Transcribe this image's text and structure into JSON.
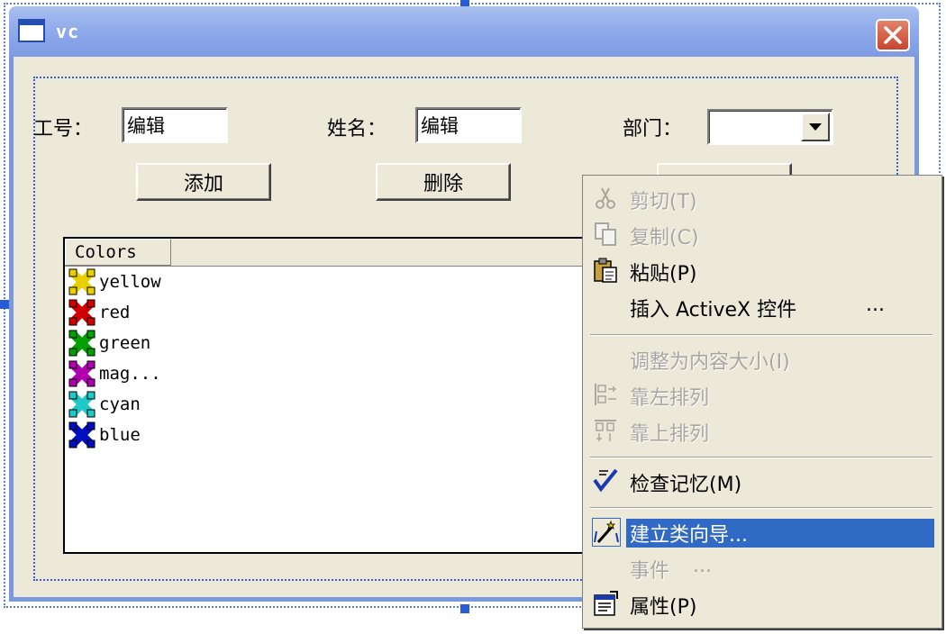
{
  "window": {
    "title": "vc",
    "close_glyph": "✕"
  },
  "form": {
    "emp_no_label": "工号：",
    "emp_no_value": "编辑",
    "name_label": "姓名：",
    "name_value": "编辑",
    "dept_label": "部门：",
    "dept_value": "",
    "add_button": "添加",
    "delete_button": "删除",
    "third_button": ""
  },
  "listview": {
    "column_header": "Colors",
    "items": [
      {
        "label": "yellow",
        "color": "#e8d000"
      },
      {
        "label": "red",
        "color": "#d00000"
      },
      {
        "label": "green",
        "color": "#00a000"
      },
      {
        "label": "mag...",
        "color": "#b000b0"
      },
      {
        "label": "cyan",
        "color": "#20c8c8"
      },
      {
        "label": "blue",
        "color": "#0010c0"
      }
    ]
  },
  "context_menu": {
    "cut": "剪切(T)",
    "copy": "复制(C)",
    "paste": "粘贴(P)",
    "insert_activex": "插入 ActiveX 控件",
    "insert_activex_ellipsis": "...",
    "size_to_content": "调整为内容大小(I)",
    "align_left": "靠左排列",
    "align_top": "靠上排列",
    "check_mnemonics": "检查记忆(M)",
    "class_wizard": "建立类向导...",
    "events": "事件",
    "events_ellipsis": "...",
    "properties": "属性(P)"
  },
  "colors": {
    "highlight": "#316ac5",
    "dialog_bg": "#ece9d8",
    "titlebar": "#8eaaea",
    "disabled_text": "#a7a6a0"
  }
}
